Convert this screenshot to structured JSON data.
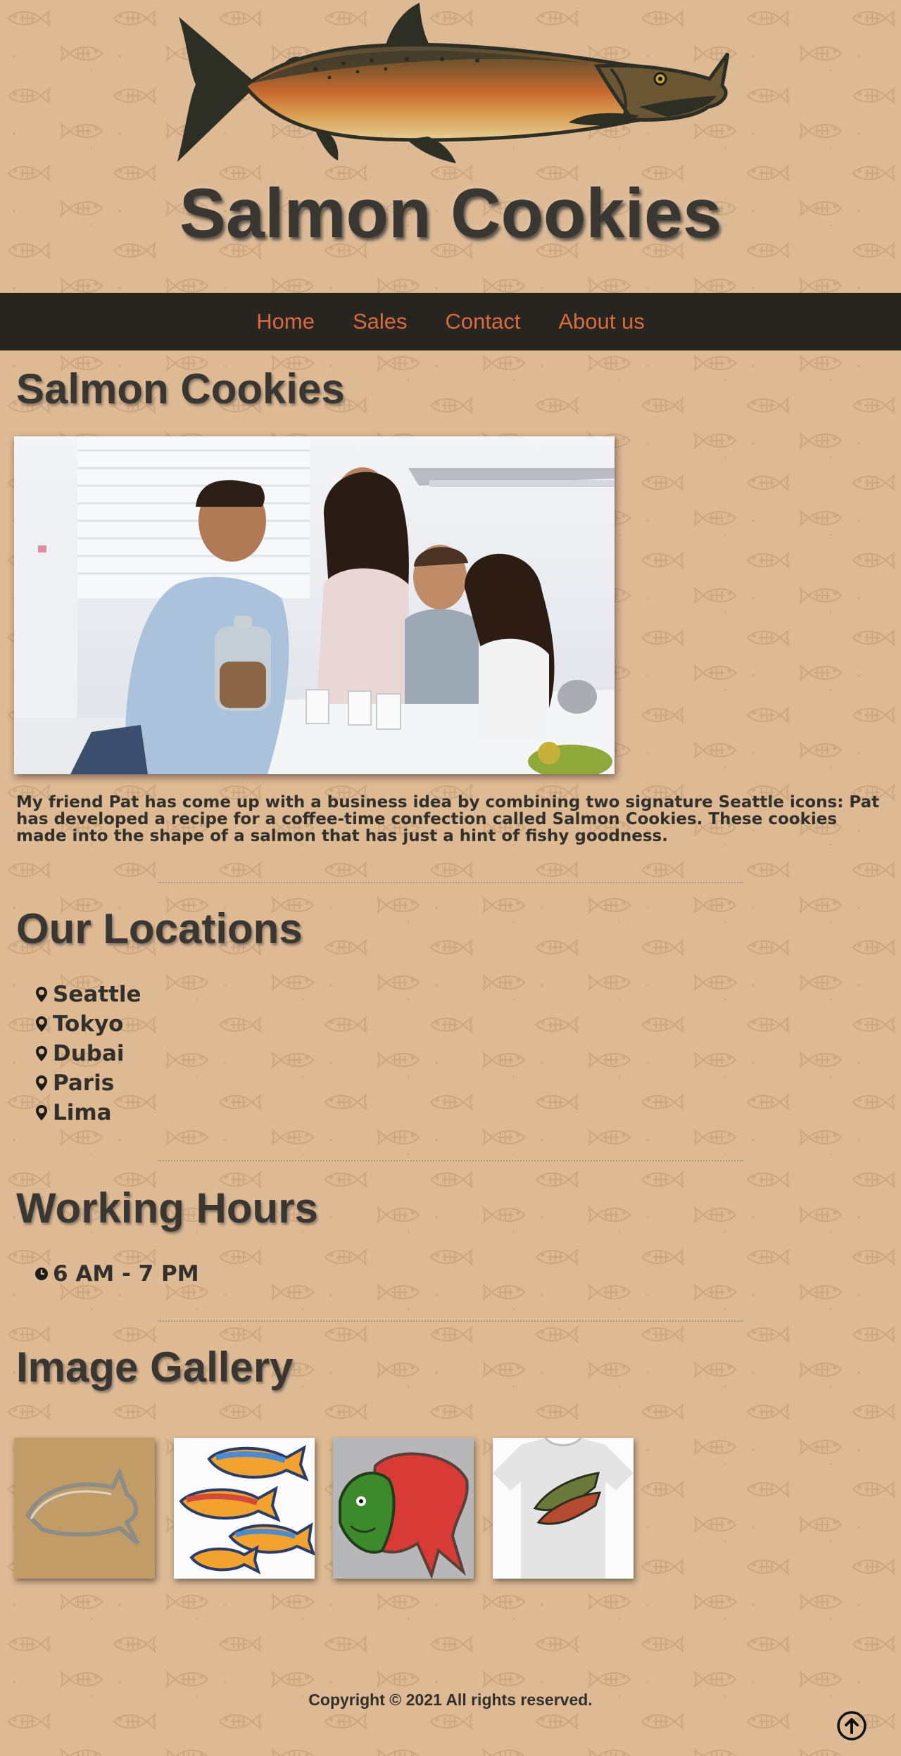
{
  "header": {
    "title": "Salmon Cookies",
    "logo_icon": "salmon-fish-illustration"
  },
  "nav": {
    "items": [
      "Home",
      "Sales",
      "Contact",
      "About us"
    ],
    "color": "#d86a40",
    "background": "#28241f"
  },
  "main": {
    "heading": "Salmon Cookies",
    "intro": "My friend Pat has come up with a business idea by combining two signature Seattle icons: Pat has developed a recipe for a coffee-time confection called Salmon Cookies. These cookies made into the shape of a salmon that has just a hint of fishy goodness."
  },
  "locations": {
    "heading": "Our Locations",
    "icon": "map-marker-icon",
    "items": [
      "Seattle",
      "Tokyo",
      "Dubai",
      "Paris",
      "Lima"
    ]
  },
  "hours": {
    "heading": "Working Hours",
    "icon": "clock-icon",
    "items": [
      "6 AM - 7 PM"
    ]
  },
  "gallery": {
    "heading": "Image Gallery",
    "images": [
      "salmon-cookie-cutter",
      "painted-fish-cookies",
      "red-green-salmon-cookie",
      "salmon-tshirt"
    ]
  },
  "footer": {
    "copyright": "Copyright © 2021 All rights reserved.",
    "back_to_top_icon": "arrow-up-circle-icon"
  },
  "colors": {
    "background": "#ddb994",
    "text": "#33302b",
    "accent": "#d86a40"
  }
}
